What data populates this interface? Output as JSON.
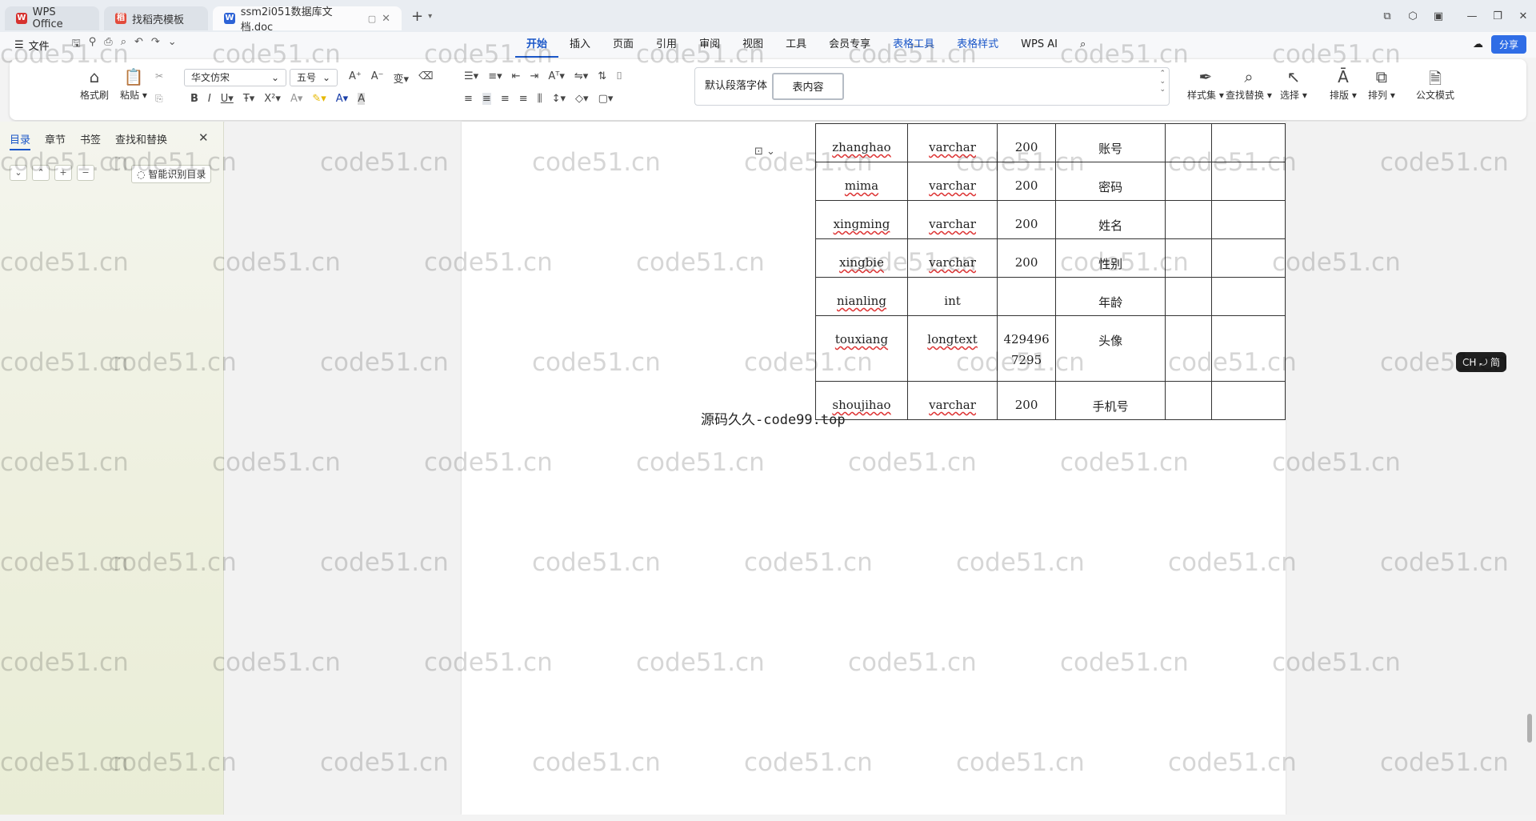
{
  "tabs": [
    {
      "label": "WPS Office",
      "state": "inactive"
    },
    {
      "label": "找稻壳模板",
      "state": "inactive"
    },
    {
      "label": "ssm2i051数据库文档.doc",
      "state": "active"
    }
  ],
  "menu": {
    "file": "文件",
    "ribbon_tabs": [
      "开始",
      "插入",
      "页面",
      "引用",
      "审阅",
      "视图",
      "工具",
      "会员专享",
      "表格工具",
      "表格样式",
      "WPS AI"
    ],
    "selected_tab": "开始",
    "share": "分享"
  },
  "ribbon": {
    "format_painter": "格式刷",
    "paste": "粘贴",
    "font_name": "华文仿宋",
    "font_size": "五号",
    "style_default": "默认段落字体",
    "style_selected": "表内容",
    "styles": "样式集",
    "find_replace": "查找替换",
    "select": "选择",
    "layout": "排版",
    "arrange": "排列",
    "official_mode": "公文模式"
  },
  "sidebar": {
    "tabs": [
      "目录",
      "章节",
      "书签",
      "查找和替换"
    ],
    "selected": "目录",
    "smart_toc": "智能识别目录"
  },
  "table": {
    "rows": [
      {
        "name": "zhanghao",
        "type": "varchar",
        "length": "200",
        "desc": "账号"
      },
      {
        "name": "mima",
        "type": "varchar",
        "length": "200",
        "desc": "密码"
      },
      {
        "name": "xingming",
        "type": "varchar",
        "length": "200",
        "desc": "姓名"
      },
      {
        "name": "xingbie",
        "type": "varchar",
        "length": "200",
        "desc": "性别"
      },
      {
        "name": "nianling",
        "type": "int",
        "length": "",
        "desc": "年龄"
      },
      {
        "name": "touxiang",
        "type": "longtext",
        "length": "4294967295",
        "length_l1": "429496",
        "length_l2": "7295",
        "desc": "头像"
      },
      {
        "name": "shoujihao",
        "type": "varchar",
        "length": "200",
        "desc": "手机号"
      }
    ]
  },
  "overlay_text": "源码久久-code99.top",
  "watermark": "code51.cn",
  "ime": "CH ⤾ 简"
}
